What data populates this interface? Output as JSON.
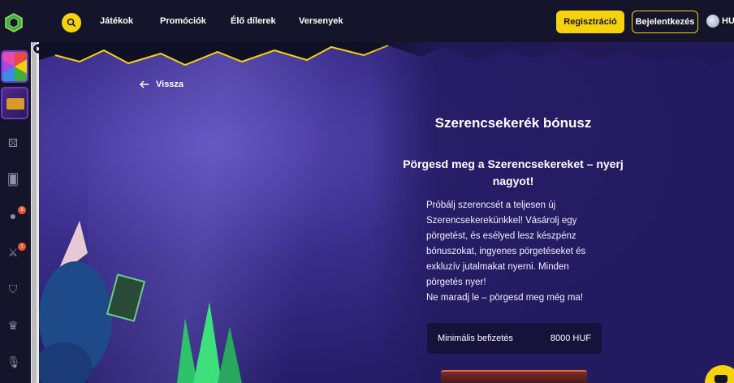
{
  "nav": {
    "links": [
      "Játékok",
      "Promóciók",
      "Élő dílerek",
      "Versenyek"
    ],
    "register": "Regisztráció",
    "login": "Bejelentkezés",
    "lang": "HU"
  },
  "rail": {
    "badges": [
      "8",
      "1"
    ]
  },
  "hero": {
    "back": "Vissza",
    "title": "Szerencsekerék bónusz",
    "subtitle": "Pörgesd meg a Szerencsekereket – nyerj nagyot!",
    "body": [
      "Próbálj szerencsét a teljesen új",
      "Szerencsekerekünkkel! Vásárolj egy",
      "pörgetést, és esélyed lesz készpénz",
      "bónuszokat, ingyenes pörgetéseket és",
      "exkluzív jutalmakat nyerni. Minden",
      "pörgetés nyer!",
      "Ne maradj le – pörgesd meg még ma!"
    ],
    "min_label": "Minimális befizetés",
    "min_value": "8000 HUF"
  },
  "colors": {
    "accent": "#f5d20b",
    "bg": "#14152b",
    "hero": "#2b2175"
  }
}
